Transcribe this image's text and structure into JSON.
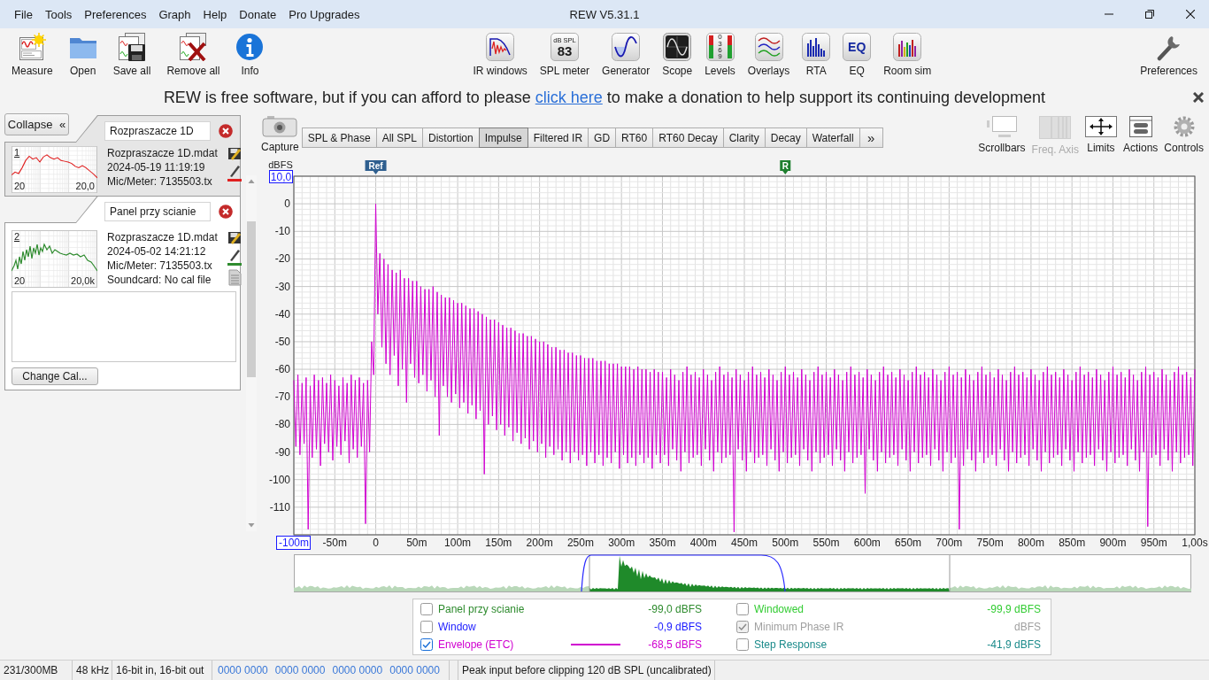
{
  "window": {
    "title": "REW V5.31.1"
  },
  "menu": [
    "File",
    "Tools",
    "Preferences",
    "Graph",
    "Help",
    "Donate",
    "Pro Upgrades"
  ],
  "toolbar": {
    "left": [
      {
        "label": "Measure"
      },
      {
        "label": "Open"
      },
      {
        "label": "Save all"
      },
      {
        "label": "Remove all"
      },
      {
        "label": "Info"
      }
    ],
    "center": [
      {
        "label": "IR windows"
      },
      {
        "label": "SPL meter",
        "icon_text": [
          "dB SPL",
          "83"
        ]
      },
      {
        "label": "Generator"
      },
      {
        "label": "Scope"
      },
      {
        "label": "Levels",
        "icon_text": [
          "0369"
        ]
      },
      {
        "label": "Overlays"
      },
      {
        "label": "RTA"
      },
      {
        "label": "EQ",
        "icon_text": [
          "EQ"
        ]
      },
      {
        "label": "Room sim"
      }
    ],
    "right": [
      {
        "label": "Preferences"
      }
    ]
  },
  "banner": {
    "text_before": "REW is free software, but if you can afford to please",
    "link": "click here",
    "text_after": "to make a donation to help support its continuing development"
  },
  "measurements_panel": {
    "collapse": {
      "label": "Collapse",
      "glyph": "«"
    },
    "measurements": [
      {
        "number": "1",
        "name": "Rozpraszacze 1D",
        "selected": false,
        "color": "#e02020",
        "axis_start": "20",
        "axis_end": "20,0",
        "info": [
          "Rozpraszacze 1D.mdat",
          "2024-05-19 11:19:19",
          "Mic/Meter: 7135503.tx"
        ]
      },
      {
        "number": "2",
        "name": "Panel przy scianie",
        "selected": true,
        "color": "#2e8b2e",
        "axis_start": "20",
        "axis_end": "20,0k",
        "info": [
          "Rozpraszacze 1D.mdat",
          "2024-05-02 14:21:12",
          "Mic/Meter: 7135503.tx",
          "Soundcard: No cal file"
        ],
        "change_cal_button": "Change Cal..."
      }
    ]
  },
  "graph": {
    "capture": "Capture",
    "tabs": [
      {
        "label": "SPL & Phase",
        "selected": false
      },
      {
        "label": "All SPL",
        "selected": false
      },
      {
        "label": "Distortion",
        "selected": false
      },
      {
        "label": "Impulse",
        "selected": true
      },
      {
        "label": "Filtered IR",
        "selected": false
      },
      {
        "label": "GD",
        "selected": false
      },
      {
        "label": "RT60",
        "selected": false
      },
      {
        "label": "RT60 Decay",
        "selected": false
      },
      {
        "label": "Clarity",
        "selected": false
      },
      {
        "label": "Decay",
        "selected": false
      },
      {
        "label": "Waterfall",
        "selected": false
      }
    ],
    "more_tabs": "»",
    "tools": [
      {
        "label": "Scrollbars",
        "disabled": false
      },
      {
        "label": "Freq. Axis",
        "disabled": true
      },
      {
        "label": "Limits",
        "disabled": false
      },
      {
        "label": "Actions",
        "disabled": false
      },
      {
        "label": "Controls",
        "disabled": false
      }
    ],
    "y_max_field": "10,0",
    "x_min_field": "-100m",
    "x_max_label": "1,00s",
    "markers": [
      {
        "label": "Ref",
        "color": "#2f5f8f"
      },
      {
        "label": "R",
        "color": "#1f7f2f"
      }
    ],
    "chart_data": {
      "type": "line",
      "ylabel": "dBFS",
      "grid": true,
      "xlim": [
        -100,
        1000
      ],
      "ylim": [
        -120,
        10
      ],
      "xticks": [
        {
          "value": -50,
          "label": "-50m"
        },
        {
          "value": 0,
          "label": "0"
        },
        {
          "value": 50,
          "label": "50m"
        },
        {
          "value": 100,
          "label": "100m"
        },
        {
          "value": 150,
          "label": "150m"
        },
        {
          "value": 200,
          "label": "200m"
        },
        {
          "value": 250,
          "label": "250m"
        },
        {
          "value": 300,
          "label": "300m"
        },
        {
          "value": 350,
          "label": "350m"
        },
        {
          "value": 400,
          "label": "400m"
        },
        {
          "value": 450,
          "label": "450m"
        },
        {
          "value": 500,
          "label": "500m"
        },
        {
          "value": 550,
          "label": "550m"
        },
        {
          "value": 600,
          "label": "600m"
        },
        {
          "value": 650,
          "label": "650m"
        },
        {
          "value": 700,
          "label": "700m"
        },
        {
          "value": 750,
          "label": "750m"
        },
        {
          "value": 800,
          "label": "800m"
        },
        {
          "value": 850,
          "label": "850m"
        },
        {
          "value": 900,
          "label": "900m"
        },
        {
          "value": 950,
          "label": "950m"
        }
      ],
      "yticks": [
        0,
        -10,
        -20,
        -30,
        -40,
        -50,
        -60,
        -70,
        -80,
        -90,
        -100,
        -110
      ],
      "x": [
        -100,
        -97.5,
        -95,
        -92.5,
        -90,
        -87.5,
        -85,
        -82.5,
        -80,
        -77.5,
        -75,
        -72.5,
        -70,
        -67.5,
        -65,
        -62.5,
        -60,
        -57.5,
        -55,
        -52.5,
        -50,
        -47.5,
        -45,
        -42.5,
        -40,
        -37.5,
        -35,
        -32.5,
        -30,
        -27.5,
        -25,
        -22.5,
        -20,
        -17.5,
        -15,
        -12.5,
        -10,
        -7.5,
        -5,
        -2.5,
        0,
        2.5,
        5,
        7.5,
        10,
        12.5,
        15,
        17.5,
        20,
        22.5,
        25,
        27.5,
        30,
        32.5,
        35,
        37.5,
        40,
        42.5,
        45,
        47.5,
        50,
        52.5,
        55,
        57.5,
        60,
        62.5,
        65,
        67.5,
        70,
        72.5,
        75,
        77.5,
        80,
        82.5,
        85,
        87.5,
        90,
        92.5,
        95,
        97.5,
        100,
        102.5,
        105,
        107.5,
        110,
        112.5,
        115,
        117.5,
        120,
        122.5,
        125,
        127.5,
        130,
        132.5,
        135,
        137.5,
        140,
        142.5,
        145,
        147.5,
        150,
        152.5,
        155,
        157.5,
        160,
        162.5,
        165,
        167.5,
        170,
        172.5,
        175,
        177.5,
        180,
        182.5,
        185,
        187.5,
        190,
        192.5,
        195,
        197.5,
        200,
        202.5,
        205,
        207.5,
        210,
        212.5,
        215,
        217.5,
        220,
        222.5,
        225,
        227.5,
        230,
        232.5,
        235,
        237.5,
        240,
        242.5,
        245,
        247.5,
        250,
        252.5,
        255,
        257.5,
        260,
        262.5,
        265,
        267.5,
        270,
        272.5,
        275,
        277.5,
        280,
        282.5,
        285,
        287.5,
        290,
        292.5,
        295,
        297.5,
        300,
        302.5,
        305,
        307.5,
        310,
        312.5,
        315,
        317.5,
        320,
        322.5,
        325,
        327.5,
        330,
        332.5,
        335,
        337.5,
        340,
        342.5,
        345,
        347.5,
        350,
        352.5,
        355,
        357.5,
        360,
        362.5,
        365,
        367.5,
        370,
        372.5,
        375,
        377.5,
        380,
        382.5,
        385,
        387.5,
        390,
        392.5,
        395,
        397.5,
        400,
        402.5,
        405,
        407.5,
        410,
        412.5,
        415,
        417.5,
        420,
        422.5,
        425,
        427.5,
        430,
        432.5,
        435,
        437.5,
        440,
        442.5,
        445,
        447.5,
        450,
        452.5,
        455,
        457.5,
        460,
        462.5,
        465,
        467.5,
        470,
        472.5,
        475,
        477.5,
        480,
        482.5,
        485,
        487.5,
        490,
        492.5,
        495,
        497.5,
        500,
        502.5,
        505,
        507.5,
        510,
        512.5,
        515,
        517.5,
        520,
        522.5,
        525,
        527.5,
        530,
        532.5,
        535,
        537.5,
        540,
        542.5,
        545,
        547.5,
        550,
        552.5,
        555,
        557.5,
        560,
        562.5,
        565,
        567.5,
        570,
        572.5,
        575,
        577.5,
        580,
        582.5,
        585,
        587.5,
        590,
        592.5,
        595,
        597.5,
        600,
        602.5,
        605,
        607.5,
        610,
        612.5,
        615,
        617.5,
        620,
        622.5,
        625,
        627.5,
        630,
        632.5,
        635,
        637.5,
        640,
        642.5,
        645,
        647.5,
        650,
        652.5,
        655,
        657.5,
        660,
        662.5,
        665,
        667.5,
        670,
        672.5,
        675,
        677.5,
        680,
        682.5,
        685,
        687.5,
        690,
        692.5,
        695,
        697.5,
        700,
        702.5,
        705,
        707.5,
        710,
        712.5,
        715,
        717.5,
        720,
        722.5,
        725,
        727.5,
        730,
        732.5,
        735,
        737.5,
        740,
        742.5,
        745,
        747.5,
        750,
        752.5,
        755,
        757.5,
        760,
        762.5,
        765,
        767.5,
        770,
        772.5,
        775,
        777.5,
        780,
        782.5,
        785,
        787.5,
        790,
        792.5,
        795,
        797.5,
        800,
        802.5,
        805,
        807.5,
        810,
        812.5,
        815,
        817.5,
        820,
        822.5,
        825,
        827.5,
        830,
        832.5,
        835,
        837.5,
        840,
        842.5,
        845,
        847.5,
        850,
        852.5,
        855,
        857.5,
        860,
        862.5,
        865,
        867.5,
        870,
        872.5,
        875,
        877.5,
        880,
        882.5,
        885,
        887.5,
        890,
        892.5,
        895,
        897.5,
        900,
        902.5,
        905,
        907.5,
        910,
        912.5,
        915,
        917.5,
        920,
        922.5,
        925,
        927.5,
        930,
        932.5,
        935,
        937.5,
        940,
        942.5,
        945,
        947.5,
        950,
        952.5,
        955,
        957.5,
        960,
        962.5,
        965,
        967.5,
        970,
        972.5,
        975,
        977.5,
        980,
        982.5,
        985,
        987.5,
        990,
        992.5,
        995,
        997.5,
        1000
      ],
      "series": [
        {
          "color": "#d000d0",
          "values": [
            -64,
            -88,
            -62,
            -91,
            -65,
            -87,
            -63,
            -118,
            -66,
            -92,
            -62,
            -89,
            -64,
            -95,
            -63,
            -87,
            -65,
            -90,
            -62,
            -93,
            -64,
            -88,
            -66,
            -91,
            -63,
            -86,
            -65,
            -94,
            -62,
            -89,
            -64,
            -92,
            -63,
            -88,
            -65,
            -116,
            -64,
            -90,
            -50,
            -62,
            0,
            -40,
            -18,
            -52,
            -20,
            -58,
            -22,
            -62,
            -24,
            -55,
            -25,
            -66,
            -24,
            -60,
            -27,
            -72,
            -27,
            -58,
            -28,
            -63,
            -28,
            -65,
            -30,
            -62,
            -31,
            -68,
            -31,
            -64,
            -30,
            -70,
            -32,
            -84,
            -33,
            -66,
            -34,
            -70,
            -34,
            -72,
            -35,
            -69,
            -36,
            -74,
            -36,
            -72,
            -37,
            -76,
            -38,
            -73,
            -38,
            -78,
            -39,
            -75,
            -40,
            -98,
            -41,
            -80,
            -42,
            -77,
            -42,
            -82,
            -43,
            -80,
            -44,
            -84,
            -45,
            -81,
            -45,
            -86,
            -46,
            -83,
            -47,
            -87,
            -47,
            -85,
            -48,
            -89,
            -48,
            -86,
            -49,
            -90,
            -50,
            -87,
            -50,
            -92,
            -51,
            -88,
            -52,
            -91,
            -52,
            -89,
            -53,
            -93,
            -53,
            -90,
            -54,
            -94,
            -54,
            -90,
            -55,
            -93,
            -55,
            -91,
            -56,
            -95,
            -56,
            -90,
            -56,
            -94,
            -57,
            -91,
            -57,
            -95,
            -57,
            -92,
            -58,
            -94,
            -58,
            -90,
            -58,
            -96,
            -59,
            -91,
            -59,
            -94,
            -59,
            -92,
            -60,
            -95,
            -59,
            -91,
            -60,
            -94,
            -60,
            -92,
            -61,
            -96,
            -60,
            -91,
            -61,
            -94,
            -61,
            -91,
            -63,
            -95,
            -60,
            -89,
            -62,
            -93,
            -64,
            -97,
            -61,
            -90,
            -59,
            -94,
            -62,
            -92,
            -61,
            -91,
            -63,
            -95,
            -60,
            -89,
            -62,
            -93,
            -64,
            -97,
            -61,
            -90,
            -59,
            -94,
            -62,
            -92,
            -61,
            -91,
            -63,
            -119,
            -60,
            -89,
            -62,
            -93,
            -64,
            -97,
            -61,
            -90,
            -59,
            -94,
            -62,
            -92,
            -61,
            -91,
            -63,
            -95,
            -60,
            -89,
            -62,
            -93,
            -64,
            -97,
            -61,
            -90,
            -59,
            -94,
            -62,
            -92,
            -61,
            -91,
            -63,
            -95,
            -60,
            -89,
            -62,
            -93,
            -64,
            -97,
            -61,
            -90,
            -59,
            -94,
            -62,
            -92,
            -61,
            -91,
            -63,
            -95,
            -60,
            -89,
            -62,
            -93,
            -64,
            -97,
            -61,
            -90,
            -59,
            -94,
            -62,
            -92,
            -61,
            -91,
            -63,
            -105,
            -60,
            -89,
            -62,
            -93,
            -64,
            -97,
            -61,
            -90,
            -59,
            -94,
            -62,
            -92,
            -61,
            -91,
            -63,
            -95,
            -60,
            -89,
            -62,
            -93,
            -64,
            -97,
            -61,
            -90,
            -59,
            -94,
            -62,
            -92,
            -61,
            -91,
            -63,
            -95,
            -60,
            -89,
            -62,
            -93,
            -64,
            -97,
            -61,
            -90,
            -59,
            -94,
            -62,
            -92,
            -61,
            -118,
            -63,
            -95,
            -60,
            -89,
            -62,
            -93,
            -64,
            -97,
            -61,
            -90,
            -59,
            -94,
            -62,
            -92,
            -61,
            -91,
            -63,
            -95,
            -60,
            -89,
            -62,
            -93,
            -64,
            -97,
            -61,
            -90,
            -59,
            -94,
            -62,
            -92,
            -61,
            -91,
            -63,
            -95,
            -60,
            -89,
            -62,
            -93,
            -64,
            -97,
            -61,
            -90,
            -59,
            -94,
            -62,
            -92,
            -61,
            -91,
            -63,
            -95,
            -60,
            -89,
            -62,
            -93,
            -64,
            -97,
            -61,
            -90,
            -59,
            -94,
            -62,
            -92,
            -61,
            -91,
            -63,
            -95,
            -60,
            -89,
            -62,
            -93,
            -64,
            -97,
            -61,
            -90,
            -59,
            -94,
            -62,
            -92,
            -61,
            -91,
            -63,
            -95,
            -60,
            -89,
            -62,
            -93,
            -64,
            -97,
            -61,
            -90,
            -59,
            -117,
            -62,
            -92,
            -61,
            -91,
            -63,
            -95,
            -60,
            -89,
            -62,
            -93,
            -64,
            -97,
            -61,
            -90,
            -59,
            -94,
            -62,
            -92,
            -61,
            -91,
            -63,
            -95,
            -60
          ]
        }
      ]
    }
  },
  "legend": {
    "items": [
      {
        "label": "Panel przy scianie",
        "checked": false,
        "disabled": false,
        "color": "#2e8b2e",
        "value": "-99,0 dBFS"
      },
      {
        "label": "Window",
        "checked": false,
        "disabled": false,
        "color": "#1a1aff",
        "value": "-0,9 dBFS"
      },
      {
        "label": "Envelope (ETC)",
        "checked": true,
        "disabled": false,
        "color": "#d000d0",
        "value": "-68,5 dBFS"
      },
      {
        "label": "Windowed",
        "checked": false,
        "disabled": false,
        "color": "#33cc33",
        "value": "-99,9 dBFS"
      },
      {
        "label": "Minimum Phase IR",
        "checked": true,
        "disabled": true,
        "color": "#a0a0a0",
        "value": "dBFS"
      },
      {
        "label": "Step Response",
        "checked": false,
        "disabled": false,
        "color": "#1a8a8a",
        "value": "-41,9 dBFS"
      }
    ]
  },
  "status_bar": {
    "memory": "231/300MB",
    "sample_rate": "48 kHz",
    "bit_depth": "16-bit in, 16-bit out",
    "levels": [
      "0000 0000",
      "0000 0000",
      "0000 0000",
      "0000 0000"
    ],
    "message": "Peak input before clipping 120 dB SPL (uncalibrated)"
  }
}
